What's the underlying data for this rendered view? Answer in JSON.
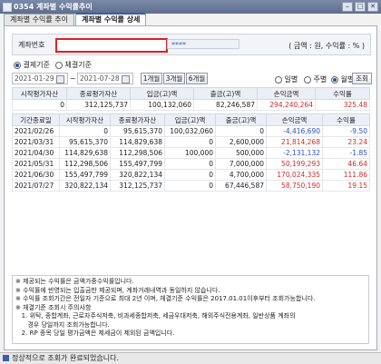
{
  "window": {
    "title": "0354 계좌별 수익률추이"
  },
  "tabs": [
    "계좌별 수익률 추이",
    "계좌별 수익률 상세"
  ],
  "form": {
    "account_label": "계좌번호",
    "account_mask": "****",
    "unit_note": "( 금액 : 원, 수익률 : % )",
    "basis": [
      "결제기준",
      "체결기준"
    ],
    "start_date": "2021-01-29",
    "end_date": "2021-07-28",
    "range_buttons": [
      "1개월",
      "3개월",
      "6개월"
    ],
    "period": [
      "일별",
      "주별",
      "월별"
    ],
    "query_button": "조회"
  },
  "summary": {
    "headers": [
      "시작평가자산",
      "종료평가자산",
      "입금(고)액",
      "출금(고)액",
      "손익금액",
      "수익률"
    ],
    "values": [
      "0",
      "312,125,737",
      "100,132,060",
      "82,246,587",
      "294,240,264",
      "325.48"
    ]
  },
  "detail": {
    "headers": [
      "기간종료일",
      "시작평가자산",
      "종료평가자산",
      "입금(고)액",
      "출금(고)액",
      "손익금액",
      "수익률"
    ],
    "rows": [
      [
        "2021/02/26",
        "0",
        "95,615,370",
        "100,032,060",
        "0",
        "-4,416,690",
        "-9.50"
      ],
      [
        "2021/03/31",
        "95,615,370",
        "114,829,638",
        "0",
        "2,600,000",
        "21,814,268",
        "23.24"
      ],
      [
        "2021/04/30",
        "114,829,638",
        "112,298,506",
        "100,000",
        "500,000",
        "-2,131,132",
        "-1.85"
      ],
      [
        "2021/05/31",
        "112,298,506",
        "155,497,799",
        "0",
        "7,000,000",
        "50,199,293",
        "46.64"
      ],
      [
        "2021/06/30",
        "155,497,799",
        "320,822,134",
        "0",
        "4,700,000",
        "170,024,335",
        "111.86"
      ],
      [
        "2021/07/27",
        "320,822,134",
        "312,125,737",
        "0",
        "67,446,587",
        "58,750,190",
        "19.15"
      ]
    ]
  },
  "notes": [
    "※ 제공되는 수익률은 금액가중수익률입니다.",
    "※ 수익률에 반영되는 입출금만 제공되며, 계좌거래내역과 동일하지 않습니다.",
    "※ 수익률 조회기간은 전일자 기준으로 최대 2년 이며, 체결기준 수익률은 2017.01.01이후부터 조회가능합니다.",
    "※ 체결기준 조회시 주의사항",
    "   1. 위탁, 종합계좌, 근로자주식저축, 비과세종합저축, 세금우대저축, 해외주식전용계좌, 일반상품 계좌의",
    "      경우 당일까지 조회가능합니다.",
    "   2. RP 종목 당일 평가금액은 제세금이 제외된 금액입니다."
  ],
  "status": {
    "message": "정상적으로 조회가 완료되었습니다."
  }
}
